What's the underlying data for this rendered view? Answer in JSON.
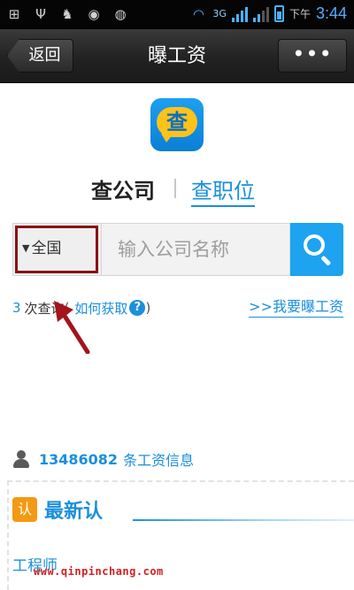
{
  "status_bar": {
    "left_icons": [
      "add-icon",
      "usb-icon",
      "android-icon",
      "app-icon",
      "app-icon-2"
    ],
    "network_label": "3G",
    "time_prefix": "下午",
    "time": "3:44"
  },
  "header": {
    "back_label": "返回",
    "title": "曝工资",
    "more_label": "•••"
  },
  "logo": {
    "glyph": "查"
  },
  "tabs": {
    "company": "查公司",
    "job": "查职位"
  },
  "search": {
    "region": "全国",
    "placeholder": "输入公司名称"
  },
  "query": {
    "count": "3",
    "count_label": "次查询",
    "open_paren": "(",
    "how_link": "如何获取",
    "help_glyph": "?",
    "close_paren": ")",
    "expose_link": ">>我要曝工资"
  },
  "salary_count": {
    "number": "13486082",
    "label": "条工资信息"
  },
  "latest": {
    "badge": "认",
    "title": "最新认",
    "first_item": "工程师"
  },
  "watermark": "www.qinpinchang.com",
  "colors": {
    "accent": "#1a8fdc",
    "highlight": "#8a1212",
    "badge": "#f39a12"
  }
}
